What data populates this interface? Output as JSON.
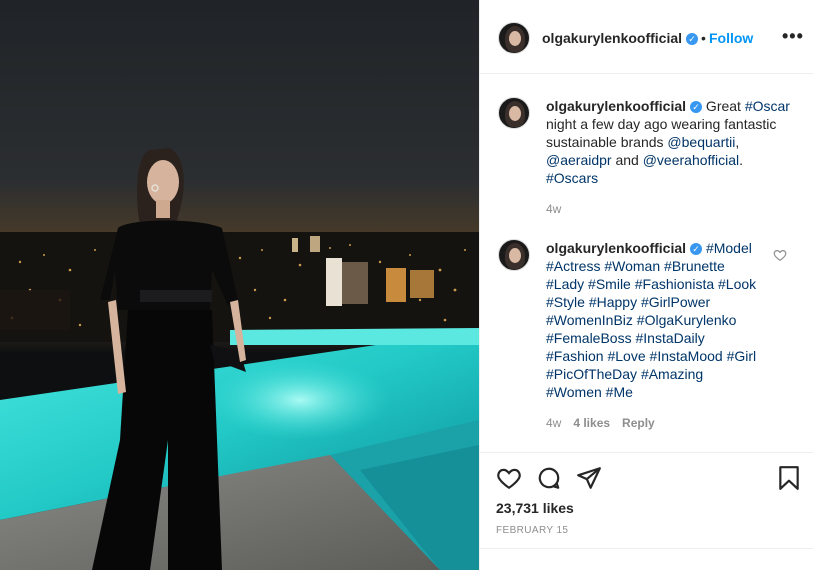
{
  "post": {
    "username": "olgakurylenkoofficial",
    "verified_mark": "✓",
    "separator": "•",
    "follow_label": "Follow",
    "more_label": "•••"
  },
  "caption": {
    "username": "olgakurylenkoofficial",
    "verified_mark": "✓",
    "segments": [
      {
        "text": " Great ",
        "tag": false
      },
      {
        "text": "#Oscar",
        "tag": true
      },
      {
        "text": " night a few day ago wearing fantastic sustainable brands ",
        "tag": false
      },
      {
        "text": "@bequartii",
        "tag": true
      },
      {
        "text": ", ",
        "tag": false
      },
      {
        "text": "@aeraidpr",
        "tag": true
      },
      {
        "text": " and ",
        "tag": false
      },
      {
        "text": "@veerahofficial",
        "tag": true
      },
      {
        "text": ". ",
        "tag": false
      },
      {
        "text": "#Oscars",
        "tag": true
      }
    ],
    "time": "4w"
  },
  "comment": {
    "username": "olgakurylenkoofficial",
    "verified_mark": "✓",
    "hashtags": [
      "#Model",
      "#Actress",
      "#Woman",
      "#Brunette",
      "#Lady",
      "#Smile",
      "#Fashionista",
      "#Look",
      "#Style",
      "#Happy",
      "#GirlPower",
      "#WomenInBiz",
      "#OlgaKurylenko",
      "#FemaleBoss",
      "#InstaDaily",
      "#Fashion",
      "#Love",
      "#InstaMood",
      "#Girl",
      "#PicOfTheDay",
      "#Amazing",
      "#Women",
      "#Me"
    ],
    "time": "4w",
    "likes": "4 likes",
    "reply_label": "Reply"
  },
  "actions": {
    "like_icon": "heart-icon",
    "comment_icon": "comment-icon",
    "share_icon": "share-icon",
    "save_icon": "bookmark-icon",
    "likes_text": "23,731 likes",
    "date": "FEBRUARY 15"
  },
  "colors": {
    "link": "#0095f6",
    "tag": "#003569",
    "muted": "#8e8e8e",
    "pool": "#3fe0d8"
  }
}
